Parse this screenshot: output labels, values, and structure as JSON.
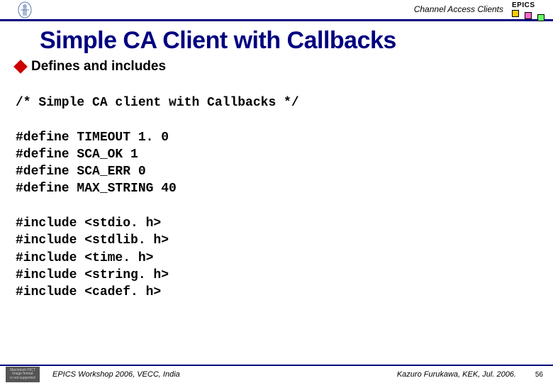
{
  "header": {
    "label": "Channel Access Clients",
    "epics_text": "EPICS"
  },
  "title": "Simple CA Client with Callbacks",
  "subheading": "Defines and includes",
  "code": "/* Simple CA client with Callbacks */\n\n#define TIMEOUT 1. 0\n#define SCA_OK 1\n#define SCA_ERR 0\n#define MAX_STRING 40\n\n#include <stdio. h>\n#include <stdlib. h>\n#include <time. h>\n#include <string. h>\n#include <cadef. h>",
  "footer": {
    "badge_line1": "Macintosh PICT",
    "badge_line2": "image format",
    "badge_line3": "is not supported",
    "left": "EPICS Workshop 2006, VECC, India",
    "right": "Kazuro Furukawa, KEK, Jul. 2006.",
    "page": "56"
  }
}
